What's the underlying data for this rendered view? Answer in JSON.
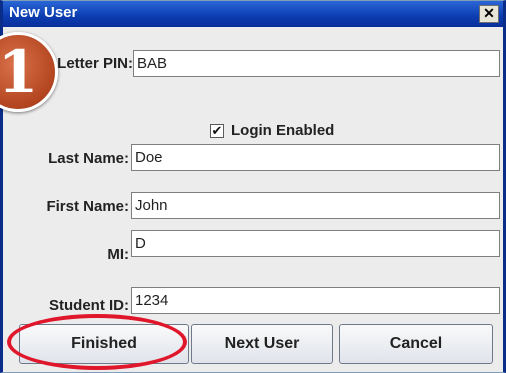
{
  "window": {
    "title": "New User",
    "close_glyph": "✕"
  },
  "annotation": {
    "step_number": "1"
  },
  "form": {
    "letter_pin": {
      "label": "Letter PIN:",
      "value": "BAB"
    },
    "login_enabled": {
      "label": "Login Enabled",
      "checked": true,
      "check_glyph": "✔"
    },
    "last_name": {
      "label": "Last Name:",
      "value": "Doe"
    },
    "first_name": {
      "label": "First Name:",
      "value": "John"
    },
    "mi": {
      "label": "MI:",
      "value": "D"
    },
    "student_id": {
      "label": "Student ID:",
      "value": "1234"
    }
  },
  "buttons": {
    "finished": "Finished",
    "next_user": "Next User",
    "cancel": "Cancel"
  },
  "colors": {
    "highlight": "#e0162b",
    "title_bar": "#0b3cb0",
    "badge": "#b2451f"
  }
}
